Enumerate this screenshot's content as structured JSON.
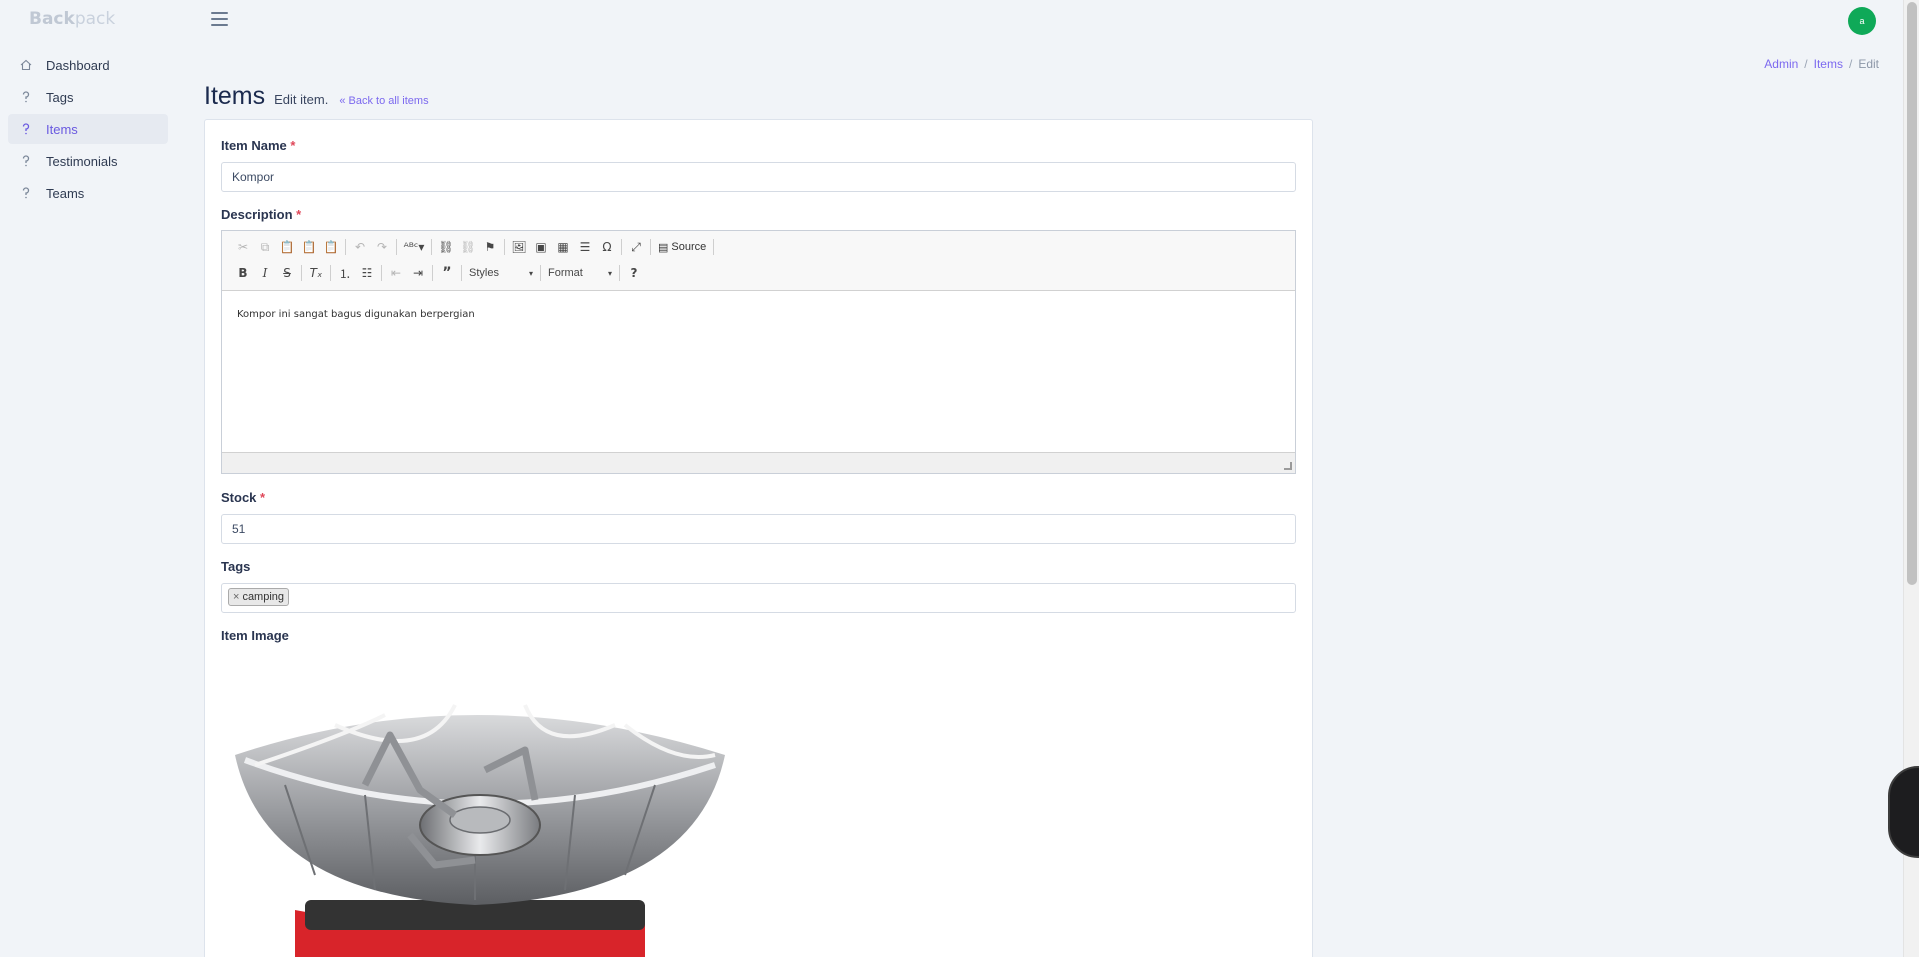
{
  "app": {
    "brand_bold": "Back",
    "brand_rest": "pack",
    "avatar_letter": "a"
  },
  "sidebar": {
    "items": [
      {
        "label": "Dashboard",
        "icon": "home-icon"
      },
      {
        "label": "Tags",
        "icon": "question-icon"
      },
      {
        "label": "Items",
        "icon": "question-icon",
        "active": true
      },
      {
        "label": "Testimonials",
        "icon": "question-icon"
      },
      {
        "label": "Teams",
        "icon": "question-icon"
      }
    ]
  },
  "breadcrumb": {
    "admin": "Admin",
    "items": "Items",
    "current": "Edit"
  },
  "header": {
    "title": "Items",
    "subtitle": "Edit item.",
    "back_link": "Back to all items"
  },
  "form": {
    "item_name": {
      "label": "Item Name",
      "value": "Kompor"
    },
    "description": {
      "label": "Description",
      "content": "Kompor ini sangat bagus digunakan berpergian",
      "toolbar": {
        "styles": "Styles",
        "format": "Format",
        "source": "Source"
      }
    },
    "stock": {
      "label": "Stock",
      "value": "51"
    },
    "tags": {
      "label": "Tags",
      "values": [
        "camping"
      ],
      "remove_symbol": "×"
    },
    "image": {
      "label": "Item Image"
    },
    "required_mark": "*"
  },
  "colors": {
    "accent": "#7c69ef",
    "avatar": "#0fa958",
    "required": "#df4759"
  }
}
